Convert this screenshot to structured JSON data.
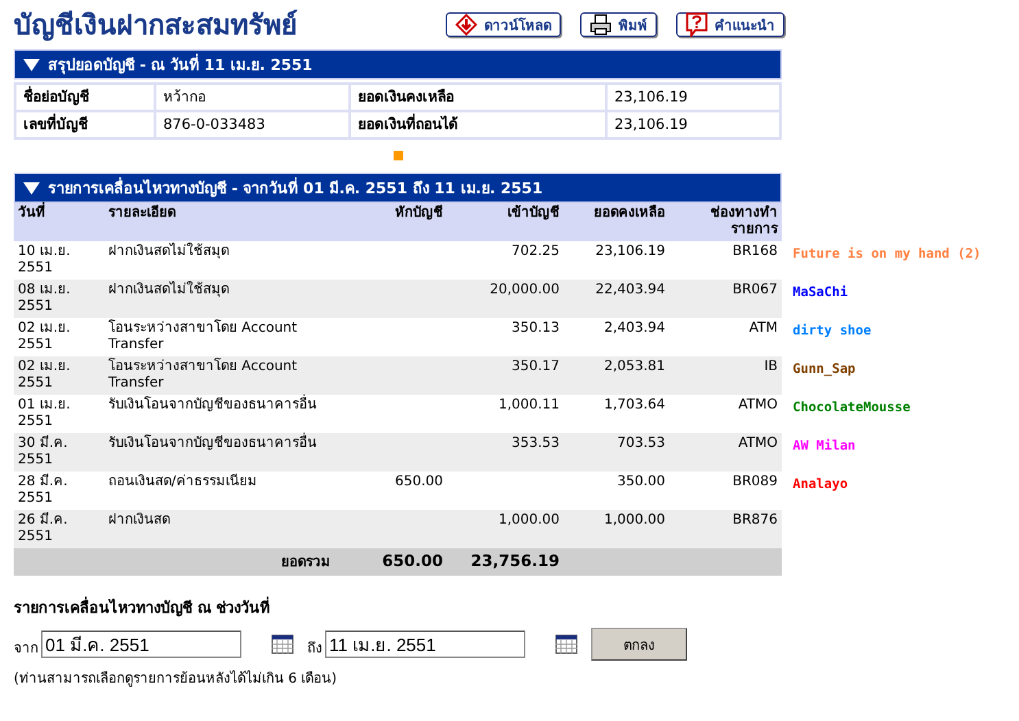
{
  "title": "บัญชีเงินฝากสะสมทรัพย์",
  "toolbar": [
    {
      "kind": "download",
      "label": "ดาวน์โหลด"
    },
    {
      "kind": "print",
      "label": "พิมพ์"
    },
    {
      "kind": "help",
      "label": "คำแนะนำ"
    }
  ],
  "summary": {
    "header": "สรุปยอดบัญชี - ณ วันที่ 11 เม.ย. 2551",
    "rows": [
      {
        "label": "ชื่อย่อบัญชี",
        "value": "หว้ากอ",
        "label_2": "ยอดเงินคงเหลือ",
        "value_2": "23,106.19"
      },
      {
        "label": "เลขที่บัญชี",
        "value": "876-0-033483",
        "label_2": "ยอดเงินที่ถอนได้",
        "value_2": "23,106.19"
      }
    ]
  },
  "transactions": {
    "header": "รายการเคลื่อนไหวทางบัญชี - จากวันที่ 01 มี.ค. 2551 ถึง 11 เม.ย. 2551",
    "columns": [
      "วันที่",
      "รายละเอียด",
      "หักบัญชี",
      "เข้าบัญชี",
      "ยอดคงเหลือ",
      "ช่องทางทำรายการ"
    ],
    "rows": [
      {
        "date": "10 เม.ย. 2551",
        "detail": "ฝากเงินสดไม่ใช้สมุด",
        "debit": "",
        "credit": "702.25",
        "balance": "23,106.19",
        "channel": "BR168",
        "tag": {
          "text": "Future is on my hand (2)",
          "color": "#ff8040"
        }
      },
      {
        "date": "08 เม.ย. 2551",
        "detail": "ฝากเงินสดไม่ใช้สมุด",
        "debit": "",
        "credit": "20,000.00",
        "balance": "22,403.94",
        "channel": "BR067",
        "tag": {
          "text": "MaSaChi",
          "color": "#0000ff"
        }
      },
      {
        "date": "02 เม.ย. 2551",
        "detail": "โอนระหว่างสาขาโดย Account Transfer",
        "debit": "",
        "credit": "350.13",
        "balance": "2,403.94",
        "channel": "ATM",
        "tag": {
          "text": "dirty shoe",
          "color": "#0080ff"
        }
      },
      {
        "date": "02 เม.ย. 2551",
        "detail": "โอนระหว่างสาขาโดย Account Transfer",
        "debit": "",
        "credit": "350.17",
        "balance": "2,053.81",
        "channel": "IB",
        "tag": {
          "text": "Gunn_Sap",
          "color": "#804000"
        }
      },
      {
        "date": "01 เม.ย. 2551",
        "detail": "รับเงินโอนจากบัญชีของธนาคารอื่น",
        "debit": "",
        "credit": "1,000.11",
        "balance": "1,703.64",
        "channel": "ATMO",
        "tag": {
          "text": "ChocolateMousse",
          "color": "#008000"
        }
      },
      {
        "date": "30 มี.ค. 2551",
        "detail": "รับเงินโอนจากบัญชีของธนาคารอื่น",
        "debit": "",
        "credit": "353.53",
        "balance": "703.53",
        "channel": "ATMO",
        "tag": {
          "text": "AW Milan",
          "color": "#ff00ff"
        }
      },
      {
        "date": "28 มี.ค. 2551",
        "detail": "ถอนเงินสด/ค่าธรรมเนียม",
        "debit": "650.00",
        "credit": "",
        "balance": "350.00",
        "channel": "BR089",
        "tag": {
          "text": "Analayo",
          "color": "#ff0000"
        }
      },
      {
        "date": "26 มี.ค. 2551",
        "detail": "ฝากเงินสด",
        "debit": "",
        "credit": "1,000.00",
        "balance": "1,000.00",
        "channel": "BR876"
      }
    ],
    "total": {
      "label": "ยอดรวม",
      "debit": "650.00",
      "credit": "23,756.19"
    }
  },
  "range": {
    "title": "รายการเคลื่อนไหวทางบัญชี ณ ช่วงวันที่",
    "from_label": "จาก",
    "from": "01 มี.ค. 2551",
    "to_label": "ถึง",
    "to": "11 เม.ย. 2551",
    "button": "ตกลง",
    "note": "(ท่านสามารถเลือกดูรายการย้อนหลังได้ไม่เกิน 6 เดือน)"
  }
}
